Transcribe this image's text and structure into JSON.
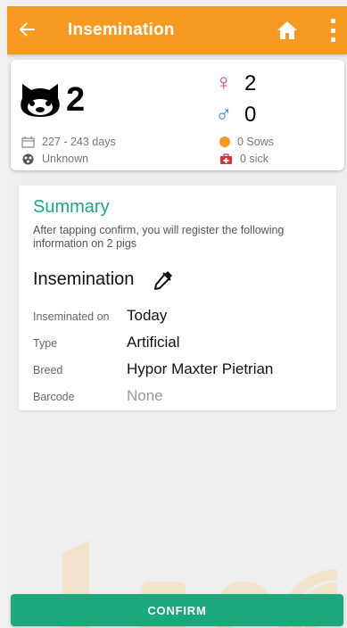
{
  "app_bar": {
    "back_icon": "arrow-left-icon",
    "title": "Insemination",
    "home_icon": "home-icon",
    "menu_icon": "more-vertical-icon",
    "background": "#f79a1f"
  },
  "animal_summary": {
    "pig_icon": "pig-face-icon",
    "count": "2",
    "female_count": "2",
    "male_count": "0",
    "age_range": "227 - 243 days",
    "genetics": "Unknown",
    "sows": "0 Sows",
    "sick": "0 sick",
    "female_color": "#e0307a",
    "male_color": "#2a8fd0"
  },
  "summary": {
    "title": "Summary",
    "description": "After tapping confirm, you will register the following information on 2 pigs",
    "section_title": "Insemination",
    "section_icon": "dropper-icon",
    "rows": [
      {
        "label": "Inseminated on",
        "value": "Today"
      },
      {
        "label": "Type",
        "value": "Artificial"
      },
      {
        "label": "Breed",
        "value": "Hypor Maxter Pietrian"
      },
      {
        "label": "Barcode",
        "value": "None"
      }
    ],
    "accent": "#1ba87d"
  },
  "confirm_button": {
    "label": "CONFIRM"
  }
}
